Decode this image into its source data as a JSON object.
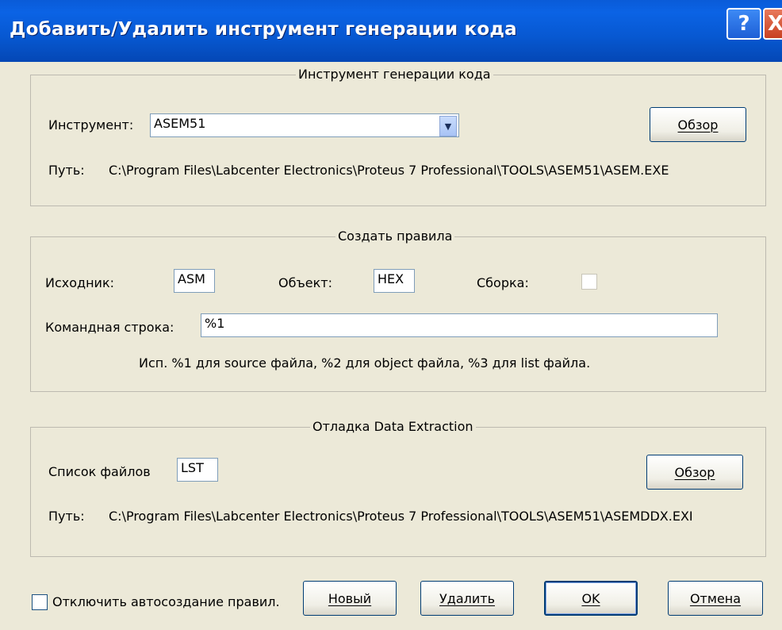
{
  "window": {
    "title": "Добавить/Удалить инструмент генерации кода",
    "help_label": "?",
    "close_label": "X"
  },
  "tool_group": {
    "legend": "Инструмент генерации кода",
    "tool_label_prefix": "Инструмент:",
    "tool_value": "ASEM51",
    "browse_label": "Обзор",
    "path_label": "Путь:",
    "path_value": "C:\\Program Files\\Labcenter Electronics\\Proteus 7 Professional\\TOOLS\\ASEM51\\ASEM.EXE"
  },
  "rules_group": {
    "legend": "Создать правила",
    "source_label": "Исходник:",
    "source_value": "ASM",
    "object_label": "Объект:",
    "object_value": "HEX",
    "build_label": "Сборка:",
    "build_checked": false,
    "cmdline_label": "Командная строка:",
    "cmdline_value": "%1",
    "hint": "Исп. %1  для source файла, %2  для object файла, %3  для list файла."
  },
  "debug_group": {
    "legend": "Отладка Data Extraction",
    "filelist_label": "Список файлов",
    "filelist_value": "LST",
    "browse_label": "Обзор",
    "path_label": "Путь:",
    "path_value": "C:\\Program Files\\Labcenter Electronics\\Proteus 7 Professional\\TOOLS\\ASEM51\\ASEMDDX.EXI"
  },
  "footer": {
    "disable_autocreate_label": "Отключить автосоздание правил.",
    "disable_autocreate_checked": false,
    "new_label": "Новый",
    "delete_label": "Удалить",
    "ok_label": "OK",
    "cancel_label": "Отмена"
  },
  "colors": {
    "titlebar": "#0758d1",
    "dialog_bg": "#ece9d8",
    "button_border": "#003c74"
  }
}
